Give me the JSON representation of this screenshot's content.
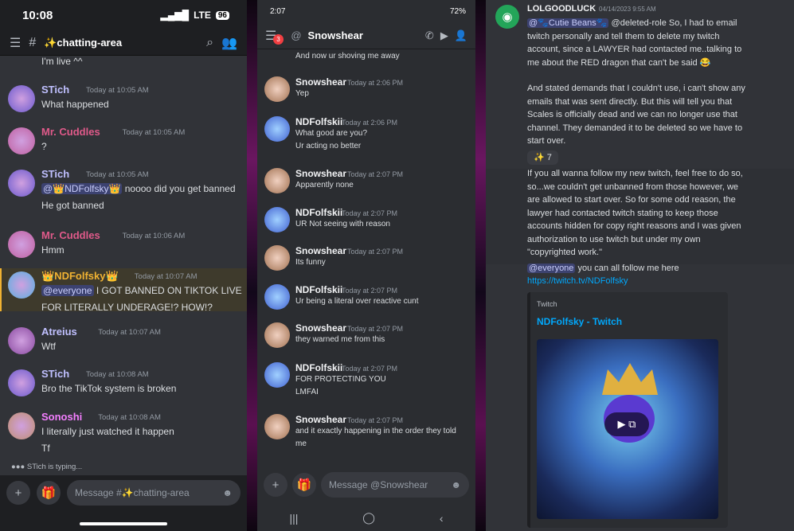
{
  "phone1": {
    "time": "10:08",
    "network": "LTE",
    "battery": "96",
    "channel": "✨chatting-area",
    "partial_msg": "I'm live ^^",
    "messages": [
      {
        "name": "STich",
        "color": "#c0c0ff",
        "time": "Today at 10:05 AM",
        "lines": [
          "What happened"
        ]
      },
      {
        "name": "Mr. Cuddles",
        "color": "#e05a8a",
        "time": "Today at 10:05 AM",
        "lines": [
          "?"
        ]
      },
      {
        "name": "STich",
        "color": "#c0c0ff",
        "time": "Today at 10:05 AM",
        "mention": "@👑NDFolfsky👑",
        "rest": " noooo did you get banned",
        "lines": [
          "He got banned"
        ]
      },
      {
        "name": "Mr. Cuddles",
        "color": "#e05a8a",
        "time": "Today at 10:06 AM",
        "lines": [
          "Hmm"
        ]
      },
      {
        "name": "👑NDFolfsky👑",
        "color": "#f0b232",
        "time": "Today at 10:07 AM",
        "mention": "@everyone",
        "rest": " I GOT BANNED ON TIKTOK LIVE",
        "lines": [
          "FOR LITERALLY UNDERAGE!? HOW!?"
        ]
      },
      {
        "name": "Atreius",
        "color": "#c0c0ff",
        "time": "Today at 10:07 AM",
        "lines": [
          "Wtf"
        ]
      },
      {
        "name": "STich",
        "color": "#c0c0ff",
        "time": "Today at 10:08 AM",
        "lines": [
          "Bro the TikTok system is broken"
        ]
      },
      {
        "name": "Sonoshi",
        "color": "#f47fff",
        "time": "Today at 10:08 AM",
        "lines": [
          "I literally just watched it happen",
          "Tf"
        ]
      }
    ],
    "typing": "STich is typing...",
    "placeholder": "Message #✨chatting-area"
  },
  "phone2": {
    "time": "2:07",
    "battery": "72%",
    "dm": "Snowshear",
    "badge": "3",
    "partial_msg": "And now ur shoving me away",
    "messages": [
      {
        "name": "Snowshear",
        "time": "Today at 2:06 PM",
        "lines": [
          "Yep"
        ]
      },
      {
        "name": "NDFolfskii",
        "time": "Today at 2:06 PM",
        "lines": [
          "What good are you?",
          "Ur acting no better"
        ]
      },
      {
        "name": "Snowshear",
        "time": "Today at 2:07 PM",
        "lines": [
          "Apparently none"
        ]
      },
      {
        "name": "NDFolfskii",
        "time": "Today at 2:07 PM",
        "lines": [
          "UR Not seeing with reason"
        ]
      },
      {
        "name": "Snowshear",
        "time": "Today at 2:07 PM",
        "lines": [
          "Its funny"
        ]
      },
      {
        "name": "NDFolfskii",
        "time": "Today at 2:07 PM",
        "lines": [
          "Ur being a literal over reactive cunt"
        ]
      },
      {
        "name": "Snowshear",
        "time": "Today at 2:07 PM",
        "lines": [
          "they warned me from this"
        ]
      },
      {
        "name": "NDFolfskii",
        "time": "Today at 2:07 PM",
        "lines": [
          "FOR PROTECTING YOU",
          "LMFAI"
        ]
      },
      {
        "name": "Snowshear",
        "time": "Today at 2:07 PM",
        "lines": [
          "and it exactly happening in the order they told",
          "me"
        ]
      }
    ],
    "placeholder": "Message @Snowshear"
  },
  "desktop": {
    "name": "LOLGOODLUCK",
    "time": "04/14/2023 9:55 AM",
    "mention": "@🐾Cutie Beans🐾",
    "p1": [
      "@deleted-role So, I had to email",
      "twitch personally and tell them to  delete my twitch",
      "account, since a LAWYER had contacted me..talking to",
      "me about the RED dragon that can't be said 😂"
    ],
    "p2": [
      "And stated demands that I couldn't use, i can't show any",
      "emails that was sent directly. But this will tell you that",
      "Scales is officially dead and we can no longer use that",
      "channel. They demanded it to be deleted so we have to",
      "start over."
    ],
    "reaction": "✨ 7",
    "p3": [
      "If you all wanna follow my new twitch, feel free to do so,",
      "so...we couldn't get unbanned from those however, we",
      "are allowed to start over. So for some odd reason, the",
      "lawyer had contacted twitch stating to keep those",
      "accounts hidden for copy right reasons and I was given",
      "authorization to use twitch but under my own",
      "\"copyrighted work.\""
    ],
    "everyone": "@everyone",
    "follow": " you can all follow me here",
    "url": "https://twitch.tv/NDFolfsky",
    "embed_provider": "Twitch",
    "embed_title": "NDFolfsky - Twitch"
  }
}
